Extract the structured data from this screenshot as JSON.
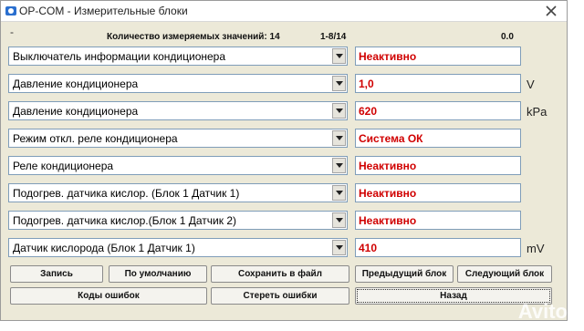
{
  "window": {
    "title": "OP-COM - Измерительные блоки",
    "menu_dash": "-"
  },
  "status": {
    "count_label": "Количество измеряемых значений: 14",
    "range": "1-8/14",
    "value": "0.0"
  },
  "rows": [
    {
      "param": "Выключатель информации кондиционера",
      "value": "Неактивно",
      "unit": ""
    },
    {
      "param": "Давление кондиционера",
      "value": "1,0",
      "unit": "V"
    },
    {
      "param": "Давление кондиционера",
      "value": "620",
      "unit": "kPa"
    },
    {
      "param": "Режим откл. реле кондиционера",
      "value": "Система ОК",
      "unit": ""
    },
    {
      "param": "Реле кондиционера",
      "value": "Неактивно",
      "unit": ""
    },
    {
      "param": "Подогрев. датчика кислор. (Блок 1 Датчик 1)",
      "value": "Неактивно",
      "unit": ""
    },
    {
      "param": "Подогрев. датчика кислор.(Блок 1 Датчик 2)",
      "value": "Неактивно",
      "unit": ""
    },
    {
      "param": "Датчик кислорода (Блок 1 Датчик 1)",
      "value": "410",
      "unit": "mV"
    }
  ],
  "buttons": {
    "record": "Запись",
    "default": "По умолчанию",
    "save_file": "Сохранить в файл",
    "prev_block": "Предыдущий блок",
    "next_block": "Следующий блок",
    "error_codes": "Коды ошибок",
    "clear_errors": "Стереть ошибки",
    "back": "Назад"
  },
  "colors": {
    "value_text": "#d00000",
    "window_bg": "#ece9d8"
  },
  "watermark": "Avito"
}
